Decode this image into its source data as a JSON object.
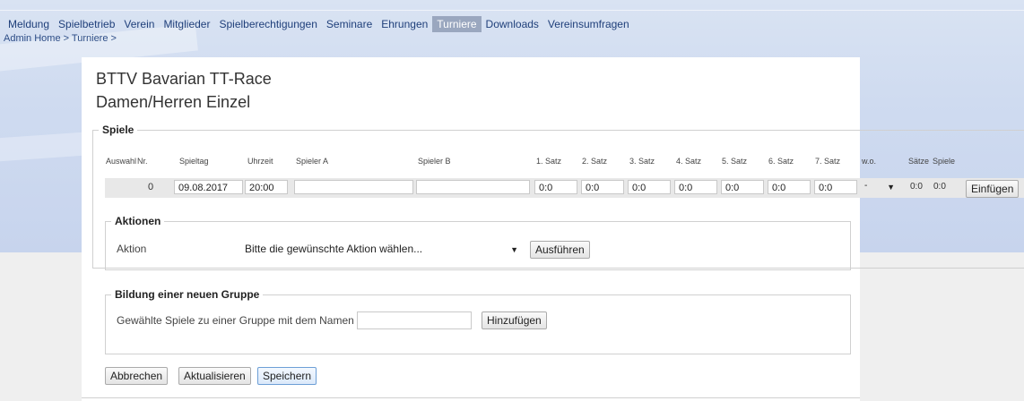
{
  "menu": [
    {
      "label": "Meldung",
      "active": false
    },
    {
      "label": "Spielbetrieb",
      "active": false
    },
    {
      "label": "Verein",
      "active": false
    },
    {
      "label": "Mitglieder",
      "active": false
    },
    {
      "label": "Spielberechtigungen",
      "active": false
    },
    {
      "label": "Seminare",
      "active": false
    },
    {
      "label": "Ehrungen",
      "active": false
    },
    {
      "label": "Turniere",
      "active": true
    },
    {
      "label": "Downloads",
      "active": false
    },
    {
      "label": "Vereinsumfragen",
      "active": false
    }
  ],
  "breadcrumb": "Admin Home > Turniere >",
  "title": {
    "line1": "BTTV Bavarian TT-Race",
    "line2": "Damen/Herren Einzel"
  },
  "spiele": {
    "legend": "Spiele",
    "columns": {
      "auswahl": "Auswahl",
      "nr": "Nr.",
      "spieltag": "Spieltag",
      "uhrzeit": "Uhrzeit",
      "spieler_a": "Spieler A",
      "spieler_b": "Spieler B",
      "satz1": "1. Satz",
      "satz2": "2. Satz",
      "satz3": "3. Satz",
      "satz4": "4. Satz",
      "satz5": "5. Satz",
      "satz6": "6. Satz",
      "satz7": "7. Satz",
      "wo": "w.o.",
      "saetze": "Sätze",
      "spiele": "Spiele"
    },
    "row": {
      "nr": "0",
      "spieltag": "09.08.2017",
      "uhrzeit": "20:00",
      "spieler_a": "",
      "spieler_b": "",
      "satz1": "0:0",
      "satz2": "0:0",
      "satz3": "0:0",
      "satz4": "0:0",
      "satz5": "0:0",
      "satz6": "0:0",
      "satz7": "0:0",
      "wo": "-",
      "saetze": "0:0",
      "spiele": "0:0"
    },
    "einfuegen_label": "Einfügen"
  },
  "aktionen": {
    "legend": "Aktionen",
    "label": "Aktion",
    "select_value": "Bitte die gewünschte Aktion wählen...",
    "run_label": "Ausführen"
  },
  "gruppe": {
    "legend": "Bildung einer neuen Gruppe",
    "label": "Gewählte Spiele zu einer Gruppe mit dem Namen",
    "name_value": "",
    "add_label": "Hinzufügen"
  },
  "footer": {
    "cancel": "Abbrechen",
    "refresh": "Aktualisieren",
    "save": "Speichern"
  }
}
